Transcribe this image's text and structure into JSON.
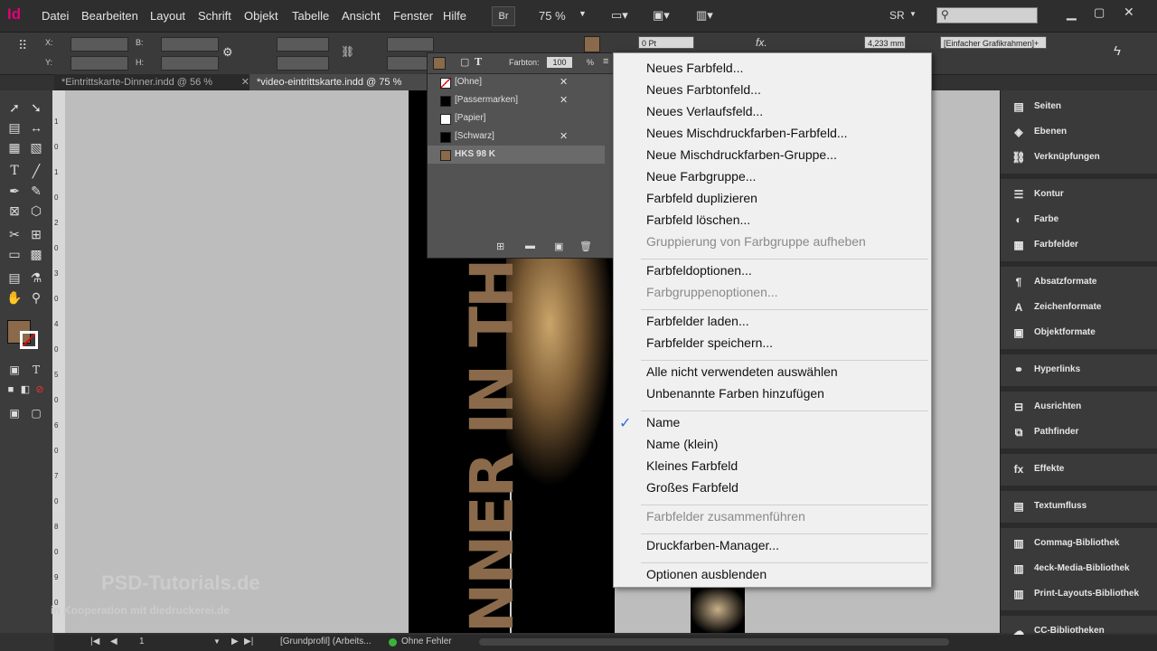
{
  "app": {
    "logo": "Id"
  },
  "menubar": {
    "items": [
      "Datei",
      "Bearbeiten",
      "Layout",
      "Schrift",
      "Objekt",
      "Tabelle",
      "Ansicht",
      "Fenster",
      "Hilfe"
    ],
    "bridge": "Br",
    "zoom": "75 %",
    "workspace": "SR"
  },
  "controlbar": {
    "x_label": "X:",
    "y_label": "Y:",
    "w_label": "B:",
    "h_label": "H:",
    "stroke_value": "0 Pt",
    "size_value": "4,233 mm",
    "frame_style": "[Einfacher Grafikrahmen]+"
  },
  "tabs": [
    {
      "label": "*Eintrittskarte-Dinner.indd @ 56 %"
    },
    {
      "label": "*video-eintrittskarte.indd @ 75 %"
    }
  ],
  "swatches": {
    "tint_label": "Farbton:",
    "tint_value": "100",
    "tint_unit": "%",
    "rows": [
      {
        "name": "[Ohne]",
        "color": "#ffffff"
      },
      {
        "name": "[Passermarken]",
        "color": "#000000"
      },
      {
        "name": "[Papier]",
        "color": "#ffffff"
      },
      {
        "name": "[Schwarz]",
        "color": "#000000"
      },
      {
        "name": "HKS 98 K",
        "color": "#8a6a4a"
      }
    ]
  },
  "menu": {
    "groups": [
      [
        {
          "label": "Neues Farbfeld...",
          "enabled": true
        },
        {
          "label": "Neues Farbtonfeld...",
          "enabled": true
        },
        {
          "label": "Neues Verlaufsfeld...",
          "enabled": true
        },
        {
          "label": "Neues Mischdruckfarben-Farbfeld...",
          "enabled": true
        },
        {
          "label": "Neue Mischdruckfarben-Gruppe...",
          "enabled": true
        },
        {
          "label": "Neue Farbgruppe...",
          "enabled": true
        },
        {
          "label": "Farbfeld duplizieren",
          "enabled": true
        },
        {
          "label": "Farbfeld löschen...",
          "enabled": true
        },
        {
          "label": "Gruppierung von Farbgruppe aufheben",
          "enabled": false
        }
      ],
      [
        {
          "label": "Farbfeldoptionen...",
          "enabled": true
        },
        {
          "label": "Farbgruppenoptionen...",
          "enabled": false
        }
      ],
      [
        {
          "label": "Farbfelder laden...",
          "enabled": true
        },
        {
          "label": "Farbfelder speichern...",
          "enabled": true
        }
      ],
      [
        {
          "label": "Alle nicht verwendeten auswählen",
          "enabled": true
        },
        {
          "label": "Unbenannte Farben hinzufügen",
          "enabled": true
        }
      ],
      [
        {
          "label": "Name",
          "enabled": true,
          "checked": true
        },
        {
          "label": "Name (klein)",
          "enabled": true
        },
        {
          "label": "Kleines Farbfeld",
          "enabled": true
        },
        {
          "label": "Großes Farbfeld",
          "enabled": true
        }
      ],
      [
        {
          "label": "Farbfelder zusammenführen",
          "enabled": false
        }
      ],
      [
        {
          "label": "Druckfarben-Manager...",
          "enabled": true
        }
      ],
      [
        {
          "label": "Optionen ausblenden",
          "enabled": true
        }
      ]
    ]
  },
  "dock": {
    "groups": [
      [
        "Seiten",
        "Ebenen",
        "Verknüpfungen"
      ],
      [
        "Kontur",
        "Farbe",
        "Farbfelder"
      ],
      [
        "Absatzformate",
        "Zeichenformate",
        "Objektformate"
      ],
      [
        "Hyperlinks"
      ],
      [
        "Ausrichten",
        "Pathfinder"
      ],
      [
        "Effekte"
      ],
      [
        "Textumfluss"
      ],
      [
        "Commag-Bibliothek",
        "4eck-Media-Bibliothek",
        "Print-Layouts-Bibliothek"
      ],
      [
        "CC-Bibliotheken"
      ]
    ]
  },
  "status": {
    "page": "1",
    "profile": "[Grundprofil] (Arbeits...",
    "preflight": "Ohne Fehler"
  },
  "canvas": {
    "vertical_text": "NNER IN THE"
  },
  "watermark": {
    "line1": "PSD-Tutorials.de",
    "line2": "in Kooperation mit diedruckerei.de"
  },
  "ruler": [
    "1",
    "0",
    "1",
    "0",
    "2",
    "0",
    "3",
    "0",
    "4",
    "0",
    "5",
    "0",
    "6",
    "0",
    "7",
    "0",
    "8",
    "0",
    "9",
    "0"
  ],
  "colors": {
    "accent_brown": "#8a6a4a",
    "indesign_pink": "#e2007a"
  }
}
